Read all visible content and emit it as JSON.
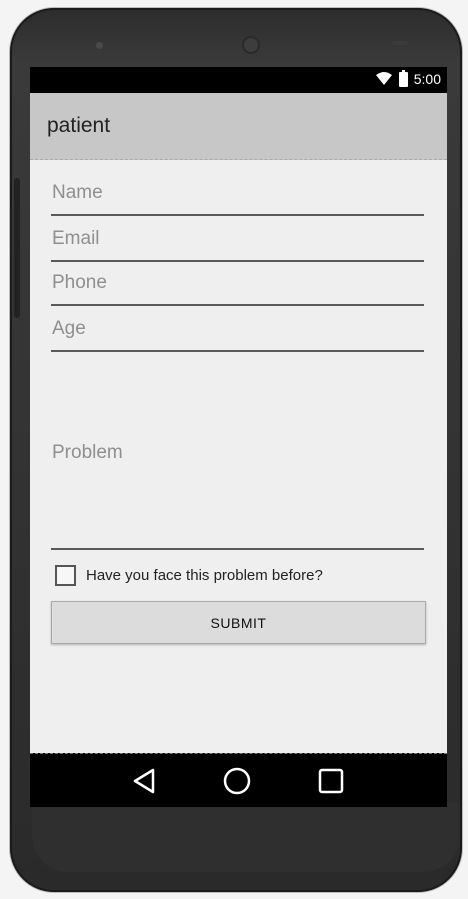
{
  "status_bar": {
    "time": "5:00",
    "wifi_icon": "wifi-icon",
    "battery_icon": "battery-icon"
  },
  "app_bar": {
    "title": "patient"
  },
  "form": {
    "name_hint": "Name",
    "email_hint": "Email",
    "phone_hint": "Phone",
    "age_hint": "Age",
    "problem_hint": "Problem",
    "checkbox_label": "Have you face this problem before?",
    "checkbox_checked": false,
    "submit_label": "SUBMIT"
  },
  "nav_bar": {
    "back_icon": "back-triangle-icon",
    "home_icon": "home-circle-icon",
    "recent_icon": "recent-apps-square-icon"
  },
  "colors": {
    "app_bar": "#c7c7c7",
    "screen_bg": "#efefef",
    "nav_bar": "#000000",
    "hint_text": "#8f8f8f"
  }
}
